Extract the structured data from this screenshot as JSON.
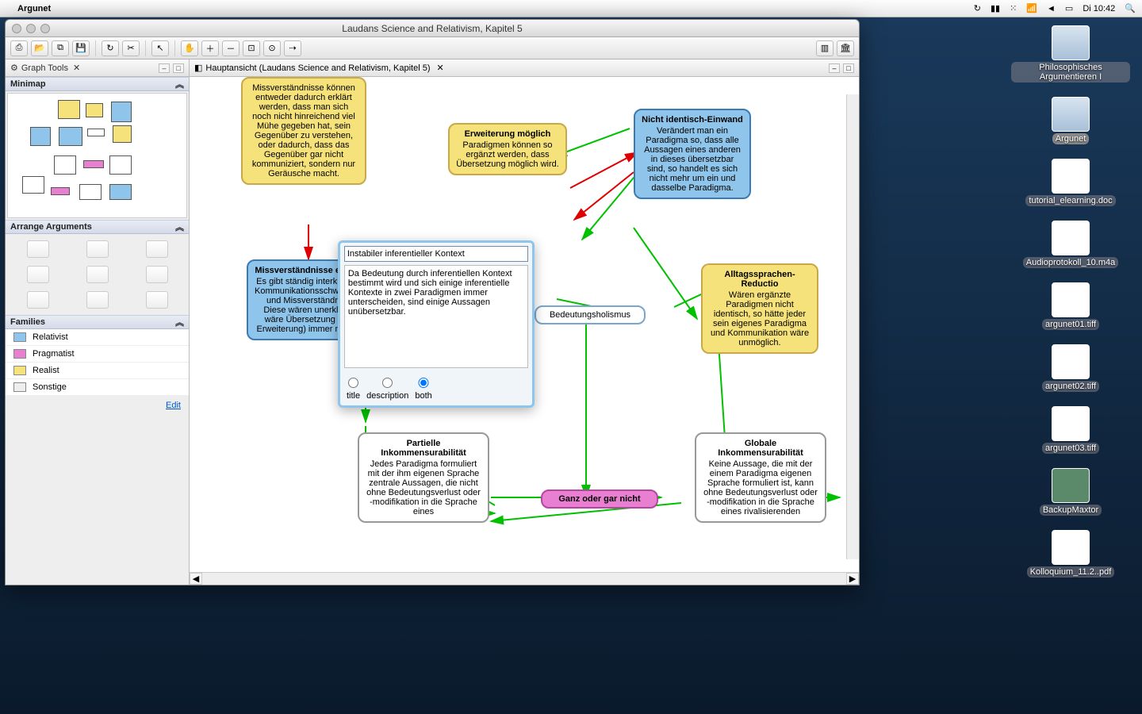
{
  "menubar": {
    "app": "Argunet",
    "clock": "Di 10:42"
  },
  "window": {
    "title": "Laudans Science and Relativism, Kapitel 5"
  },
  "sidebar": {
    "graphTools": "Graph Tools",
    "minimap": "Minimap",
    "arrange": "Arrange Arguments",
    "families": "Families",
    "familyList": [
      {
        "name": "Relativist",
        "color": "#8fc5eb"
      },
      {
        "name": "Pragmatist",
        "color": "#e87fd0"
      },
      {
        "name": "Realist",
        "color": "#f6e27a"
      },
      {
        "name": "Sonstige",
        "color": "#eeeeee"
      }
    ],
    "edit": "Edit"
  },
  "mainTab": "Hauptansicht (Laudans Science and Relativism, Kapitel 5)",
  "editor": {
    "title": "Instabiler inferentieller Kontext",
    "desc": "Da Bedeutung durch inferentiellen Kontext bestimmt wird und sich einige inferentielle Kontexte in zwei Paradigmen immer unterscheiden, sind einige Aussagen unübersetzbar.",
    "r1": "title",
    "r2": "description",
    "r3": "both"
  },
  "nodes": {
    "n1": {
      "title": "",
      "body": "Missverständnisse können entweder dadurch erklärt werden, dass man sich noch nicht hinreichend viel Mühe gegeben hat, sein Gegenüber zu verstehen, oder dadurch, dass das Gegenüber gar nicht kommuniziert, sondern nur Geräusche macht."
    },
    "n2": {
      "title": "Erweiterung möglich",
      "body": "Paradigmen können so ergänzt werden, dass Übersetzung möglich wird."
    },
    "n3": {
      "title": "Nicht identisch-Einwand",
      "body": "Verändert man ein Paradigma so, dass alle Aussagen eines anderen in dieses übersetzbar sind, so handelt es sich nicht mehr um ein und dasselbe Paradigma."
    },
    "n4": {
      "title": "Missverständnisse erklären",
      "body": "Es gibt ständig interkulturelle Kommunikationsschwierigkeiten und Missverständnisse. Diese wären unerklärbar, wäre Übersetzung (nach Erweiterung) immer möglich."
    },
    "n5": {
      "title": "",
      "body": "Bedeutungsholismus"
    },
    "n6": {
      "title": "Alltagssprachen-Reductio",
      "body": "Wären ergänzte Paradigmen nicht identisch, so hätte jeder sein eigenes Paradigma und Kommunikation wäre unmöglich."
    },
    "n7": {
      "title": "Partielle Inkommensurabilität",
      "body": "Jedes Paradigma formuliert mit der ihm eigenen Sprache zentrale Aussagen, die nicht ohne Bedeutungsverlust oder -modifikation in die Sprache eines"
    },
    "n8": {
      "title": "",
      "body": "Ganz oder gar nicht"
    },
    "n9": {
      "title": "Globale Inkommensurabilität",
      "body": "Keine Aussage, die mit der einem Paradigma eigenen Sprache formuliert ist, kann ohne Bedeutungsverlust oder -modifikation in die Sprache eines rivalisierenden"
    }
  },
  "desktop": [
    {
      "label": "Philosophisches Argumentieren I"
    },
    {
      "label": "Argunet"
    },
    {
      "label": "tutorial_elearning.doc"
    },
    {
      "label": "Audioprotokoll_10.m4a"
    },
    {
      "label": "argunet01.tiff"
    },
    {
      "label": "argunet02.tiff"
    },
    {
      "label": "argunet03.tiff"
    },
    {
      "label": "BackupMaxtor"
    },
    {
      "label": "Kolloquium_11.2..pdf"
    }
  ]
}
